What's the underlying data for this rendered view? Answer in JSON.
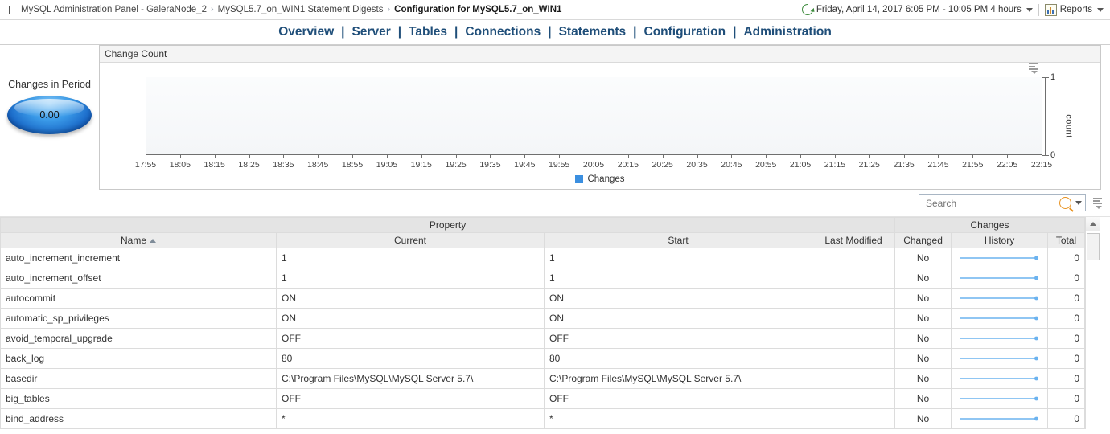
{
  "topbar": {
    "breadcrumb_icon": "panel-icon",
    "crumbs": [
      "MySQL Administration Panel - GaleraNode_2",
      "MySQL5.7_on_WIN1 Statement Digests",
      "Configuration for MySQL5.7_on_WIN1"
    ],
    "separator": "›",
    "timerange_icon": "clock-refresh-icon",
    "timerange": "Friday, April 14, 2017 6:05 PM - 10:05 PM 4 hours",
    "reports_icon": "reports-icon",
    "reports_label": "Reports"
  },
  "nav": {
    "separator": "|",
    "items": [
      "Overview",
      "Server",
      "Tables",
      "Connections",
      "Statements",
      "Configuration",
      "Administration"
    ]
  },
  "gauge": {
    "label": "Changes in Period",
    "value": "0.00"
  },
  "chart_panel": {
    "title": "Change Count",
    "menu_icon": "chart-menu-icon"
  },
  "chart_data": {
    "type": "line",
    "title": "Change Count",
    "xlabel": "",
    "ylabel": "count",
    "ylim": [
      0,
      1
    ],
    "yticks": [
      "0",
      "1"
    ],
    "grid": false,
    "legend_position": "bottom",
    "series": [
      {
        "name": "Changes",
        "color": "#3b8fe0",
        "values": [
          0,
          0,
          0,
          0,
          0,
          0,
          0,
          0,
          0,
          0,
          0,
          0,
          0,
          0,
          0,
          0,
          0,
          0,
          0,
          0,
          0,
          0,
          0,
          0,
          0,
          0,
          0
        ]
      }
    ],
    "x": [
      "17:55",
      "18:05",
      "18:15",
      "18:25",
      "18:35",
      "18:45",
      "18:55",
      "19:05",
      "19:15",
      "19:25",
      "19:35",
      "19:45",
      "19:55",
      "20:05",
      "20:15",
      "20:25",
      "20:35",
      "20:45",
      "20:55",
      "21:05",
      "21:15",
      "21:25",
      "21:35",
      "21:45",
      "21:55",
      "22:05",
      "22:15"
    ]
  },
  "search": {
    "value": "",
    "placeholder": "Search",
    "icon": "search-icon",
    "dropdown_icon": "chevron-down-icon",
    "grid_menu_icon": "grid-menu-icon"
  },
  "table": {
    "group_headers": [
      {
        "label": "Property",
        "span": 4
      },
      {
        "label": "Changes",
        "span": 3
      }
    ],
    "columns": [
      {
        "label": "Name",
        "sorted": "asc"
      },
      {
        "label": "Current"
      },
      {
        "label": "Start"
      },
      {
        "label": "Last Modified"
      },
      {
        "label": "Changed"
      },
      {
        "label": "History"
      },
      {
        "label": "Total"
      }
    ],
    "rows": [
      {
        "name": "auto_increment_increment",
        "current": "1",
        "start": "1",
        "last_modified": "",
        "changed": "No",
        "history": "sparkline",
        "total": "0"
      },
      {
        "name": "auto_increment_offset",
        "current": "1",
        "start": "1",
        "last_modified": "",
        "changed": "No",
        "history": "sparkline",
        "total": "0"
      },
      {
        "name": "autocommit",
        "current": "ON",
        "start": "ON",
        "last_modified": "",
        "changed": "No",
        "history": "sparkline",
        "total": "0"
      },
      {
        "name": "automatic_sp_privileges",
        "current": "ON",
        "start": "ON",
        "last_modified": "",
        "changed": "No",
        "history": "sparkline",
        "total": "0"
      },
      {
        "name": "avoid_temporal_upgrade",
        "current": "OFF",
        "start": "OFF",
        "last_modified": "",
        "changed": "No",
        "history": "sparkline",
        "total": "0"
      },
      {
        "name": "back_log",
        "current": "80",
        "start": "80",
        "last_modified": "",
        "changed": "No",
        "history": "sparkline",
        "total": "0"
      },
      {
        "name": "basedir",
        "current": "C:\\Program Files\\MySQL\\MySQL Server 5.7\\",
        "start": "C:\\Program Files\\MySQL\\MySQL Server 5.7\\",
        "last_modified": "",
        "changed": "No",
        "history": "sparkline",
        "total": "0"
      },
      {
        "name": "big_tables",
        "current": "OFF",
        "start": "OFF",
        "last_modified": "",
        "changed": "No",
        "history": "sparkline",
        "total": "0"
      },
      {
        "name": "bind_address",
        "current": "*",
        "start": "*",
        "last_modified": "",
        "changed": "No",
        "history": "sparkline",
        "total": "0"
      }
    ],
    "scroll_up_icon": "scroll-up-arrow-icon"
  },
  "colors": {
    "accent": "#3b8fe0",
    "nav": "#1f4e79",
    "sparkline": "#6cb3ef"
  }
}
